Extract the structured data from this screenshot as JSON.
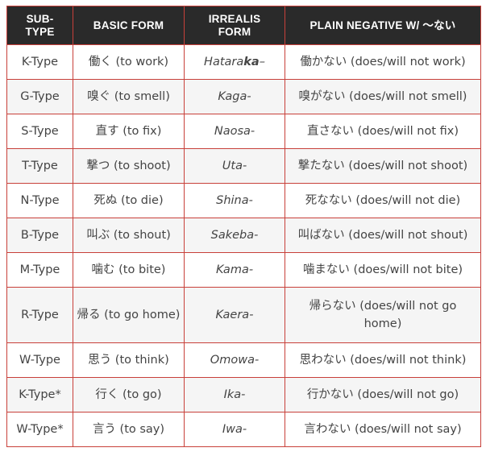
{
  "headers": [
    "SUB-\nTYPE",
    "BASIC FORM",
    "IRREALIS\nFORM",
    "PLAIN NEGATIVE W/ ～ない"
  ],
  "rows": [
    {
      "subtype": "K-Type",
      "basic": "働く (to work)",
      "irr_pre": "Hatara",
      "irr_bold": "ka",
      "irr_post": "–",
      "negative": "働かない (does/will not work)"
    },
    {
      "subtype": "G-Type",
      "basic": "嗅ぐ (to smell)",
      "irr_pre": "Kaga-",
      "irr_bold": "",
      "irr_post": "",
      "negative": "嗅がない (does/will not smell)"
    },
    {
      "subtype": "S-Type",
      "basic": "直す (to fix)",
      "irr_pre": "Naosa-",
      "irr_bold": "",
      "irr_post": "",
      "negative": "直さない (does/will not fix)"
    },
    {
      "subtype": "T-Type",
      "basic": "撃つ (to shoot)",
      "irr_pre": "Uta-",
      "irr_bold": "",
      "irr_post": "",
      "negative": "撃たない (does/will not shoot)"
    },
    {
      "subtype": "N-Type",
      "basic": "死ぬ (to die)",
      "irr_pre": "Shina-",
      "irr_bold": "",
      "irr_post": "",
      "negative": "死なない (does/will not die)"
    },
    {
      "subtype": "B-Type",
      "basic": "叫ぶ (to shout)",
      "irr_pre": "Sakeba-",
      "irr_bold": "",
      "irr_post": "",
      "negative": "叫ばない (does/will not shout)"
    },
    {
      "subtype": "M-Type",
      "basic": "噛む (to bite)",
      "irr_pre": "Kama-",
      "irr_bold": "",
      "irr_post": "",
      "negative": "噛まない (does/will not bite)"
    },
    {
      "subtype": "R-Type",
      "basic": "帰る (to go home)",
      "irr_pre": "Kaera-",
      "irr_bold": "",
      "irr_post": "",
      "negative": "帰らない (does/will not go home)"
    },
    {
      "subtype": "W-Type",
      "basic": "思う (to think)",
      "irr_pre": "Omowa-",
      "irr_bold": "",
      "irr_post": "",
      "negative": "思わない (does/will not think)"
    },
    {
      "subtype": "K-Type*",
      "basic": "行く (to go)",
      "irr_pre": "Ika-",
      "irr_bold": "",
      "irr_post": "",
      "negative": "行かない (does/will not go)"
    },
    {
      "subtype": "W-Type*",
      "basic": "言う (to say)",
      "irr_pre": "Iwa-",
      "irr_bold": "",
      "irr_post": "",
      "negative": "言わない (does/will not say)"
    }
  ]
}
